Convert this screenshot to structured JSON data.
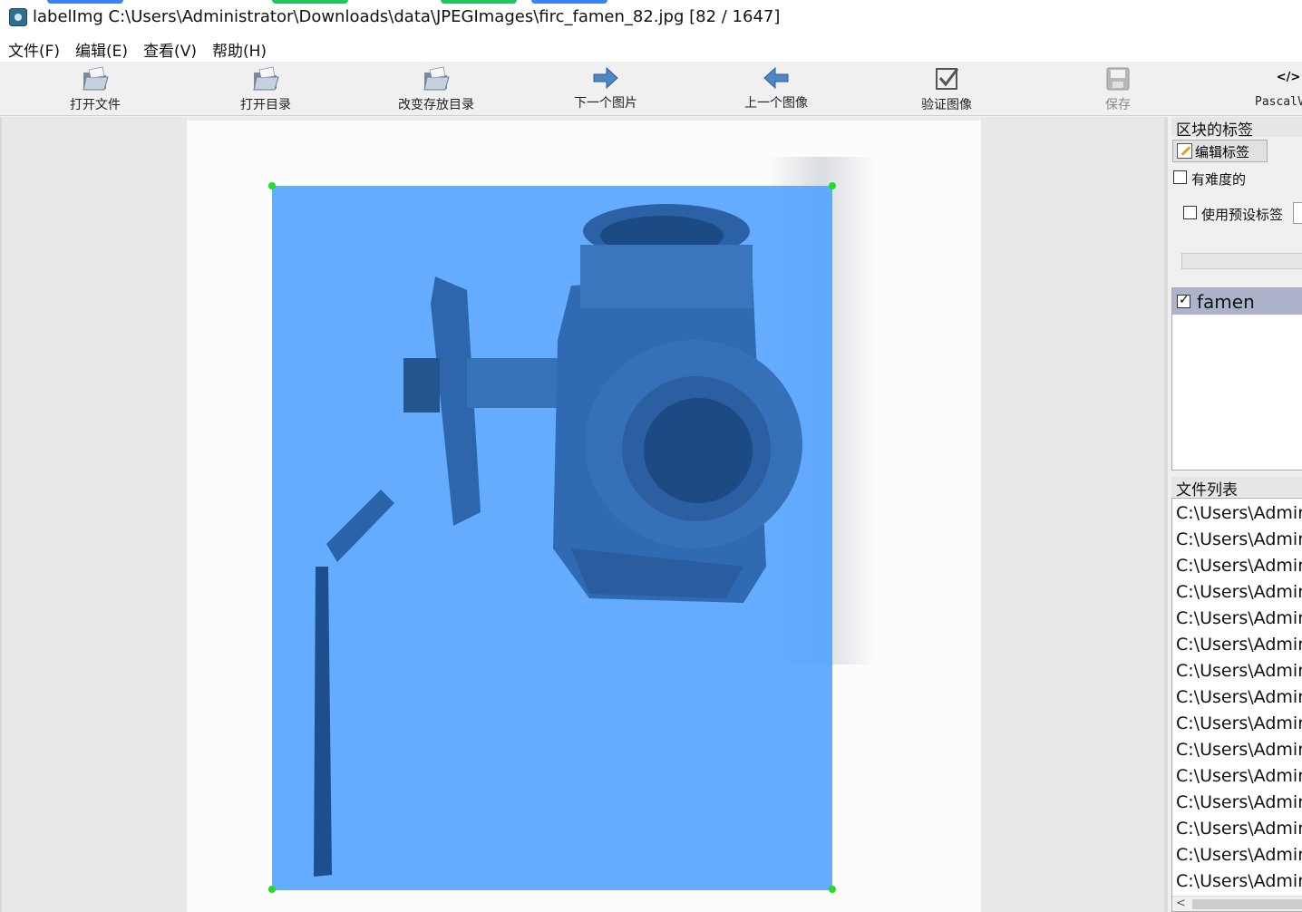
{
  "window": {
    "title": "labelImg C:\\Users\\Administrator\\Downloads\\data\\JPEGImages\\firc_famen_82.jpg [82 / 1647]"
  },
  "menu": [
    "文件(F)",
    "编辑(E)",
    "查看(V)",
    "帮助(H)"
  ],
  "toolbar": {
    "open_file": "打开文件",
    "open_dir": "打开目录",
    "change_save_dir": "改变存放目录",
    "next_image": "下一个图片",
    "prev_image": "上一个图像",
    "verify_image": "验证图像",
    "save": "保存",
    "format": "PascalV",
    "format_icon": "</>"
  },
  "dock": {
    "box_labels_title": "区块的标签",
    "edit_label_button": "编辑标签",
    "difficult_label": "有难度的",
    "use_default_label": "使用预设标签",
    "labels": [
      {
        "name": "famen",
        "checked": true
      }
    ],
    "file_list_title": "文件列表",
    "files": [
      "C:\\Users\\Admir",
      "C:\\Users\\Admir",
      "C:\\Users\\Admir",
      "C:\\Users\\Admir",
      "C:\\Users\\Admir",
      "C:\\Users\\Admir",
      "C:\\Users\\Admir",
      "C:\\Users\\Admir",
      "C:\\Users\\Admir",
      "C:\\Users\\Admir",
      "C:\\Users\\Admir",
      "C:\\Users\\Admir",
      "C:\\Users\\Admir",
      "C:\\Users\\Admir",
      "C:\\Users\\Admir"
    ]
  },
  "colors": {
    "bbox_fill": "#50a0ff",
    "handle": "#22dd22",
    "selected_label_bg": "#aeb3cc"
  }
}
